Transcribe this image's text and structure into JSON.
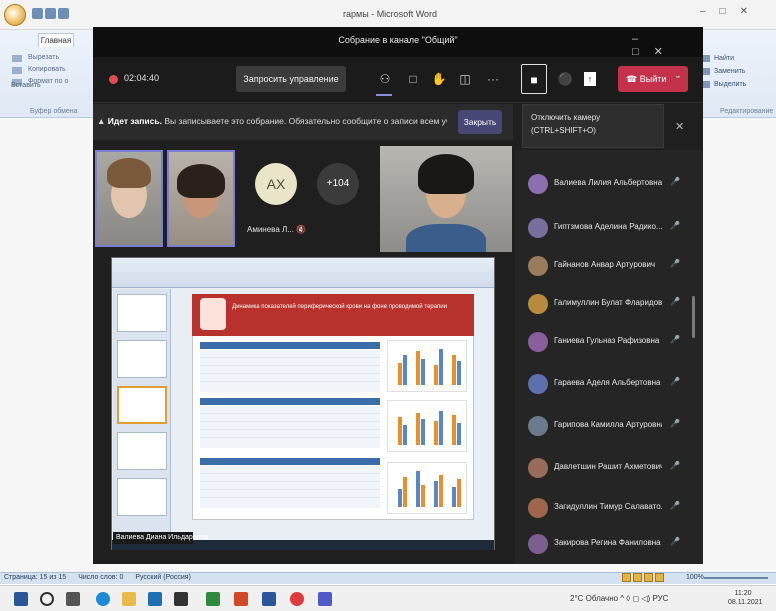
{
  "word": {
    "title": "гармы - Microsoft Word",
    "tab_home": "Главная",
    "ribbon_left": [
      "Вырезать",
      "Копировать",
      "Формат по о"
    ],
    "paste_label": "Вставить",
    "clipboard_group": "Буфер обмена",
    "ribbon_right": [
      "Найти",
      "Заменить",
      "Выделить"
    ],
    "edit_group": "Редактирование",
    "status": {
      "page": "Страница: 15 из 15",
      "words": "Число слов: 0",
      "language": "Русский (Россия)",
      "zoom": "100%"
    }
  },
  "teams": {
    "title": "Собрание в канале \"Общий\"",
    "timer": "02:04:40",
    "request_control": "Запросить управление",
    "leave": "Выйти",
    "banner_bold": "Идет запись.",
    "banner_text": "Вы записываете это собрание. Обязательно сообщите о записи всем участ...",
    "banner_close": "Закрыть",
    "tooltip_line1": "Отключить камеру",
    "tooltip_line2": "(CTRL+SHIFT+O)",
    "avatar_initials": "АХ",
    "avatar_name": "Аминева Л...",
    "more_count": "+104",
    "share_caption": "Валиева Диана Ильдаровна",
    "slide_title": "Динамика показателей периферической крови на фоне проводимой терапии",
    "participants": [
      {
        "name": "Валиева Лилия Альбертовна",
        "color": "#8b6fb0"
      },
      {
        "name": "Гиптзмова Аделина Радико...",
        "color": "#7a6e9e"
      },
      {
        "name": "Гайнанов Анвар Артурович",
        "color": "#9a7b5b"
      },
      {
        "name": "Галимуллин Булат Фларидов...",
        "color": "#b88a3c"
      },
      {
        "name": "Ганиева Гульназ Рафизовна",
        "color": "#8a5d9d"
      },
      {
        "name": "Гараева Аделя Альбертовна",
        "color": "#5e6fb0"
      },
      {
        "name": "Гарипова Камилла Артуровна",
        "color": "#6c7a8e"
      },
      {
        "name": "Давлетшин Рашит Ахметович",
        "color": "#9a6a5a"
      },
      {
        "name": "Загидуллин Тимур Салавато...",
        "color": "#a0664d"
      },
      {
        "name": "Закирова Регина Фаниловна",
        "color": "#7a5f8f"
      }
    ]
  },
  "taskbar": {
    "weather": "2°C Облачно",
    "lang": "РУС",
    "time": "11:20",
    "date": "08.11.2021"
  }
}
